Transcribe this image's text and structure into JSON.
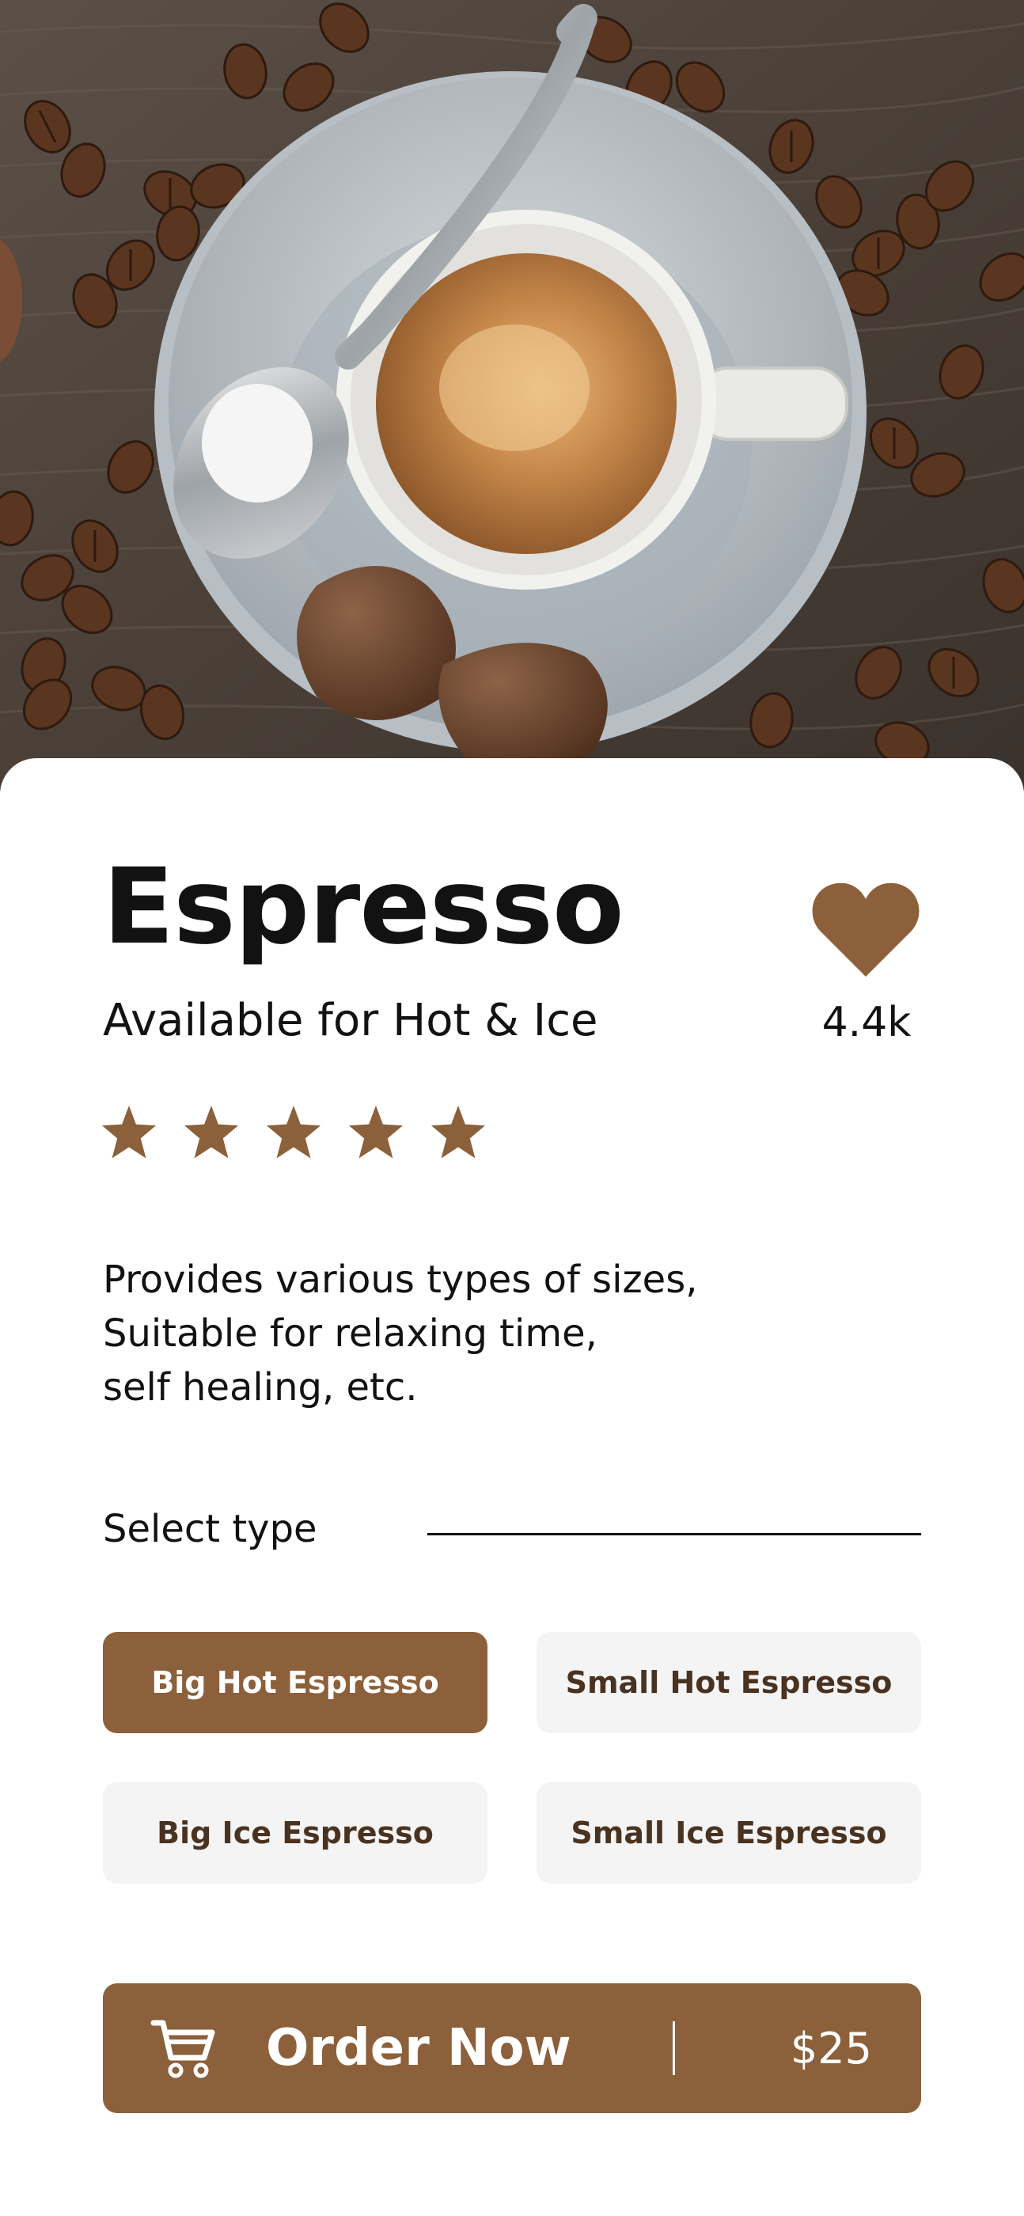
{
  "product": {
    "name": "Espresso",
    "availability": "Available for Hot & Ice",
    "favorites_count": "4.4k",
    "rating_stars": 5,
    "description_lines": [
      "Provides various types of sizes,",
      "Suitable for relaxing time,",
      "self healing, etc."
    ]
  },
  "select_type": {
    "label": "Select type",
    "options": [
      {
        "label": "Big Hot Espresso",
        "selected": true
      },
      {
        "label": "Small Hot Espresso",
        "selected": false
      },
      {
        "label": "Big Ice Espresso",
        "selected": false
      },
      {
        "label": "Small Ice Espresso",
        "selected": false
      }
    ]
  },
  "order": {
    "label": "Order Now",
    "price": "$25",
    "icon": "cart-icon"
  },
  "icons": {
    "favorite": "heart-icon",
    "rating": "star-icon"
  },
  "colors": {
    "accent": "#8c603a",
    "inactive_button_bg": "#f4f4f4",
    "inactive_button_text": "#4a3220",
    "text": "#121212"
  },
  "hero": {
    "image": "espresso-cup-photo"
  }
}
